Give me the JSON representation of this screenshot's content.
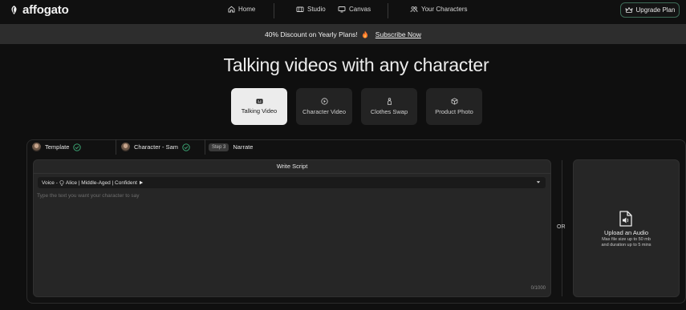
{
  "app": {
    "brand": "affogato"
  },
  "nav": {
    "home": "Home",
    "studio": "Studio",
    "canvas": "Canvas",
    "your_characters": "Your Characters",
    "upgrade": "Upgrade Plan"
  },
  "promo": {
    "text": "40% Discount on Yearly Plans!",
    "link": "Subscribe Now"
  },
  "hero": {
    "title": "Talking videos with any character"
  },
  "modes": [
    {
      "label": "Talking Video",
      "icon": "caption-icon",
      "active": true
    },
    {
      "label": "Character Video",
      "icon": "play-circle-icon",
      "active": false
    },
    {
      "label": "Clothes Swap",
      "icon": "shirt-icon",
      "active": false
    },
    {
      "label": "Product Photo",
      "icon": "cube-icon",
      "active": false
    }
  ],
  "steps": {
    "template": "Template",
    "character": "Character - Sam",
    "step_badge": "Step 3",
    "narrate": "Narrate"
  },
  "script": {
    "title": "Write Script",
    "voice_label": "Voice -",
    "voice_value": "Alice | Middle-Aged | Confident",
    "placeholder": "Type the text you want your character to say",
    "value": "",
    "char_count": "0/1000"
  },
  "or_label": "OR",
  "upload": {
    "title": "Upload an Audio",
    "line1": "Max file size up to 50 mb",
    "line2": "and duration up to 5 mins"
  },
  "colors": {
    "accent_green": "#3fae7a",
    "active_card": "#ececec",
    "flame": "#ff7a2e"
  }
}
